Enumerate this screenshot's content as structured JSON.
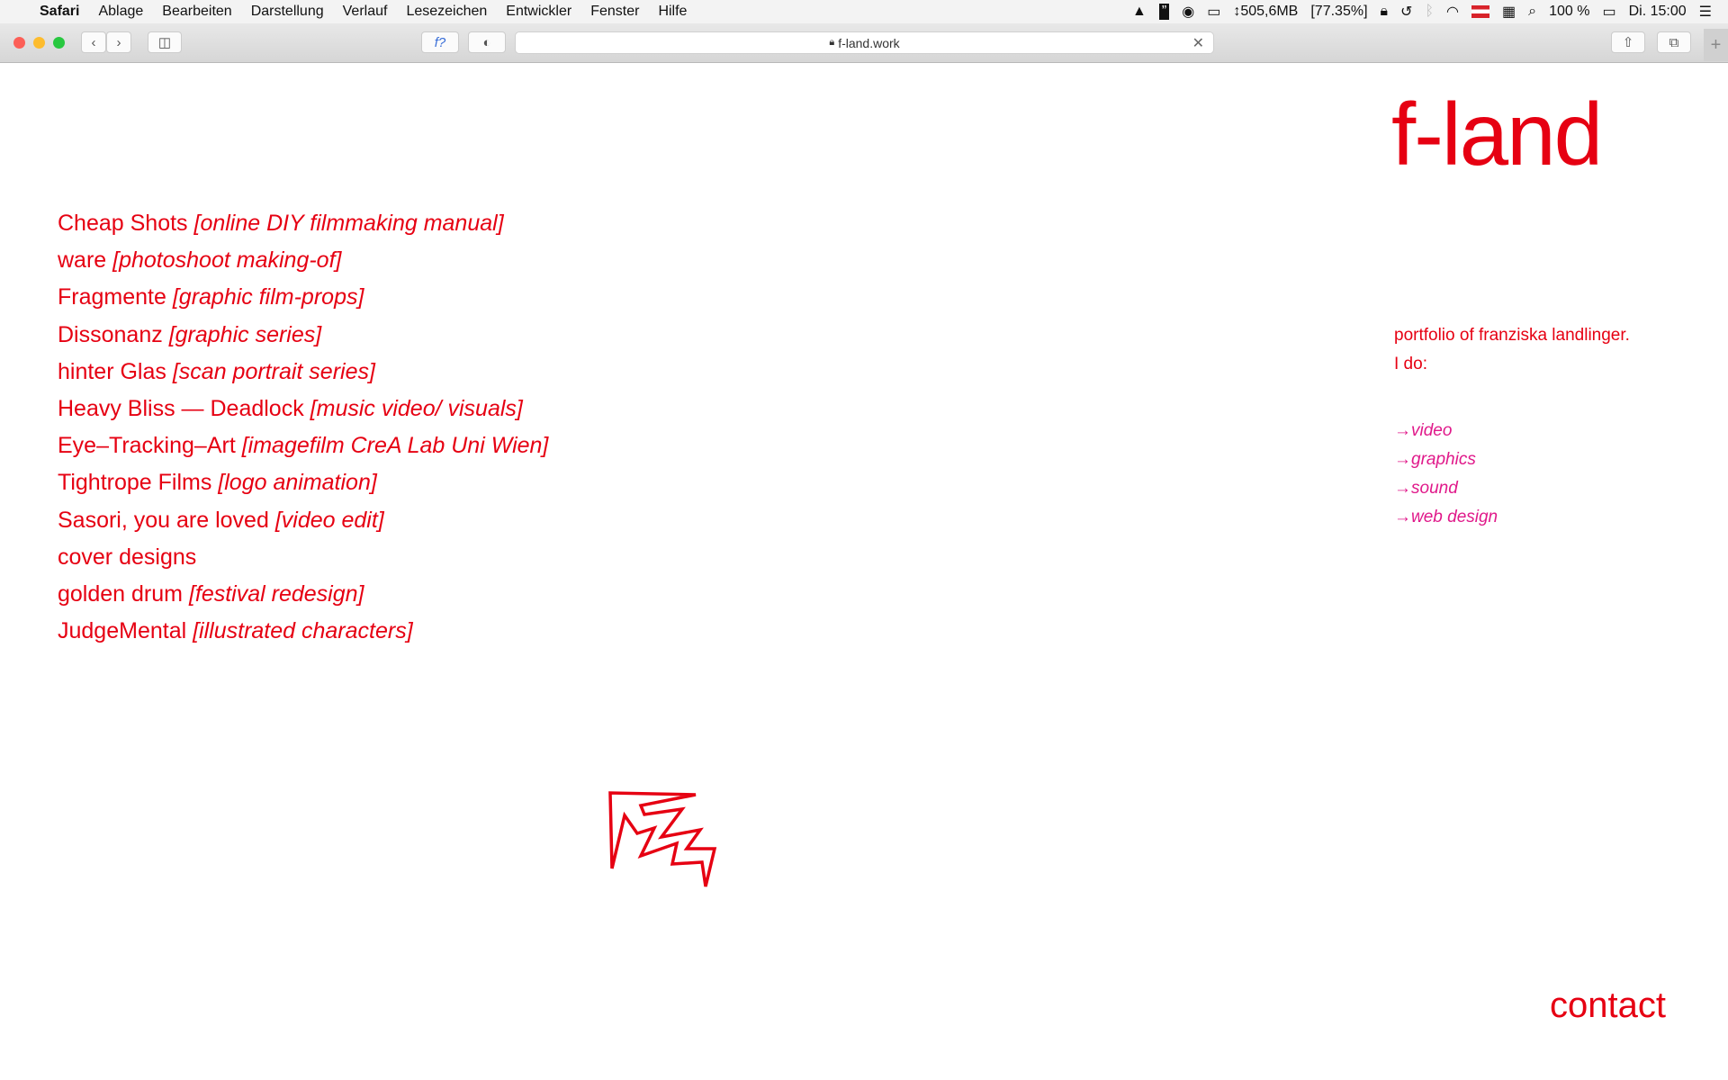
{
  "menubar": {
    "app": "Safari",
    "items": [
      "Ablage",
      "Bearbeiten",
      "Darstellung",
      "Verlauf",
      "Lesezeichen",
      "Entwickler",
      "Fenster",
      "Hilfe"
    ],
    "status": {
      "memory": "↕505,6MB",
      "cpu": "[77.35%]",
      "battery": "100 %",
      "clock": "Di. 15:00"
    }
  },
  "browser": {
    "url": "f-land.work",
    "reader_label": "f?"
  },
  "site": {
    "title": "f-land",
    "projects": [
      {
        "name": "Cheap Shots",
        "tag": "[online DIY filmmaking manual]"
      },
      {
        "name": "ware",
        "tag": "[photoshoot making-of]"
      },
      {
        "name": "Fragmente",
        "tag": "[graphic film-props]"
      },
      {
        "name": "Dissonanz",
        "tag": "[graphic series]"
      },
      {
        "name": "hinter Glas",
        "tag": "[scan portrait series]"
      },
      {
        "name": "Heavy Bliss — Deadlock",
        "tag": "[music video/ visuals]"
      },
      {
        "name": "Eye–Tracking–Art",
        "tag": "[imagefilm CreA Lab Uni Wien]"
      },
      {
        "name": "Tightrope Films",
        "tag": "[logo animation]"
      },
      {
        "name": "Sasori, you are loved",
        "tag": "[video edit]"
      },
      {
        "name": "cover designs",
        "tag": ""
      },
      {
        "name": "golden drum",
        "tag": "[festival redesign]"
      },
      {
        "name": "JudgeMental",
        "tag": "[illustrated characters]"
      }
    ],
    "about": [
      "portfolio of franziska landlinger.",
      "I do:"
    ],
    "skills": [
      "video",
      "graphics",
      "sound",
      "web design"
    ],
    "arrow": "→",
    "contact": "contact",
    "colors": {
      "primary": "#e60012",
      "links": "#e0198a"
    }
  }
}
